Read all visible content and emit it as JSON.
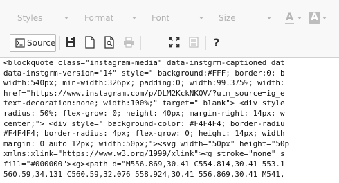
{
  "toolbar": {
    "combos": {
      "styles": "Styles",
      "format": "Format",
      "font": "Font",
      "size": "Size"
    },
    "text_color_icon": "A",
    "bg_color_icon": "A",
    "source_label": "Source",
    "icons": [
      "source-icon",
      "save-icon",
      "new-page-icon",
      "preview-icon",
      "print-icon",
      "maximize-icon",
      "show-blocks-icon",
      "help-icon"
    ],
    "help_label": "?"
  },
  "source": {
    "lines": [
      "<blockquote class=\"instagram-media\" data-instgrm-captioned dat",
      "data-instgrm-version=\"14\" style=\" background:#FFF; border:0; b",
      "width:540px; min-width:326px; padding:0; width:99.375%; width:",
      "href=\"https://www.instagram.com/p/DLM2KckNKQV/?utm_source=ig_e",
      "text-decoration:none; width:100%;\" target=\"_blank\"> <div style",
      "radius: 50%; flex-grow: 0; height: 40px; margin-right: 14px; w",
      "center;\"> <div style=\" background-color: #F4F4F4; border-radiu",
      "#F4F4F4; border-radius: 4px; flex-grow: 0; height: 14px; width",
      "margin: 0 auto 12px; width:50px;\"><svg width=\"50px\" height=\"50p",
      "xmlns:xlink=\"https://www.w3.org/1999/xlink\"><g stroke=\"none\" s",
      "fill=\"#000000\"><g><path d=\"M556.869,30.41 C554.814,30.41 553.1",
      "560.59,34.131 C560.59,32.076 558.924,30.41 556.869,30.41 M541,"
    ]
  }
}
